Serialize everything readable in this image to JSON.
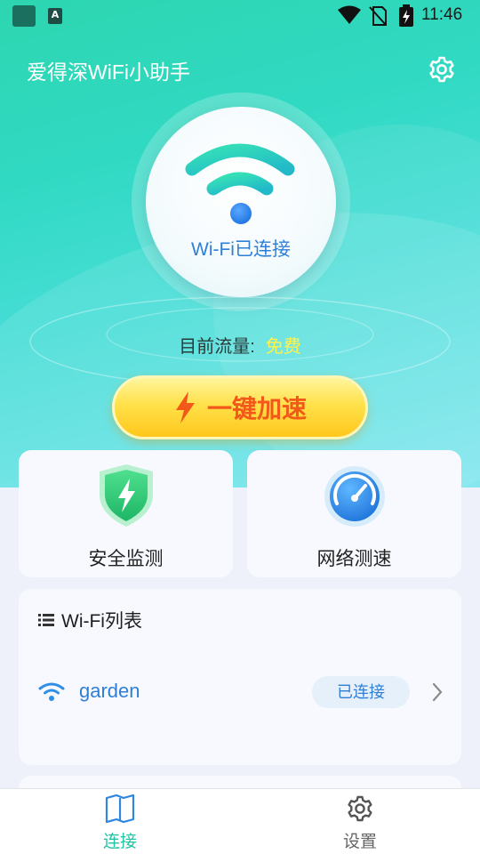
{
  "status_bar": {
    "time": "11:46",
    "notification_icon_letter": "A"
  },
  "header": {
    "title": "爱得深WiFi小助手",
    "settings_icon": "gear-icon"
  },
  "hero": {
    "wifi_status": "Wi-Fi已连接",
    "traffic_label": "目前流量:",
    "traffic_value": "免费",
    "boost_button_label": "一键加速"
  },
  "features": [
    {
      "label": "安全监测",
      "icon": "shield-bolt-icon"
    },
    {
      "label": "网络测速",
      "icon": "speedometer-icon"
    }
  ],
  "wifi_list": {
    "title": "Wi-Fi列表",
    "networks": [
      {
        "name": "garden",
        "status": "已连接"
      }
    ]
  },
  "tabbar": {
    "tabs": [
      {
        "label": "连接",
        "icon": "book-icon",
        "active": true
      },
      {
        "label": "设置",
        "icon": "gear-icon",
        "active": false
      }
    ]
  },
  "colors": {
    "hero_gradient_start": "#2dd6b0",
    "hero_gradient_end": "#79e4ee",
    "accent_blue": "#2f7fd6",
    "accent_green": "#22c3a3",
    "boost_yellow": "#ffd83a",
    "boost_text": "#f2581a",
    "free_text": "#fff34a"
  }
}
